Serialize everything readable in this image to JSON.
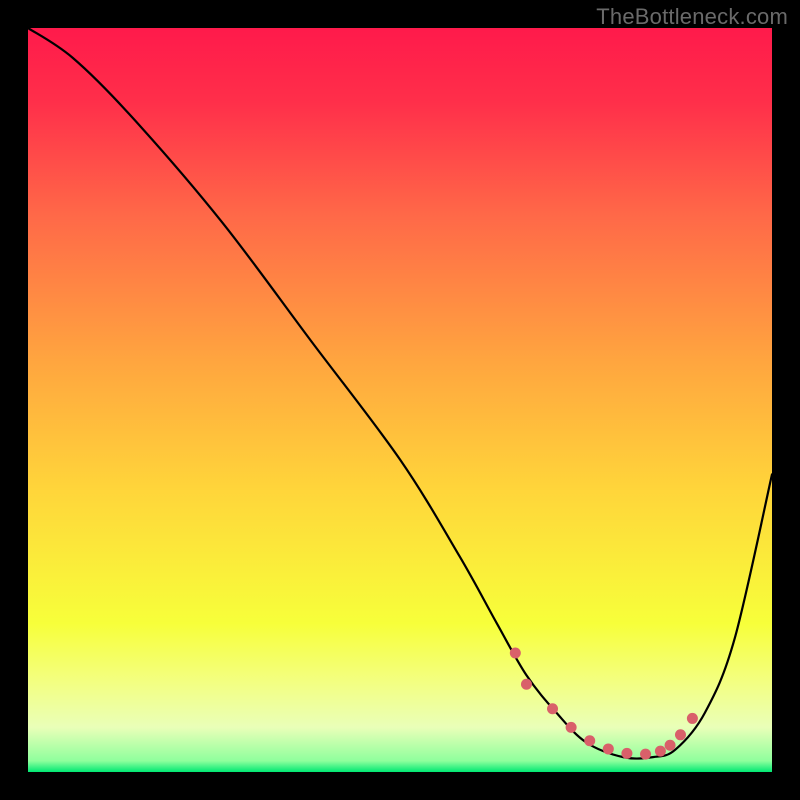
{
  "watermark": "TheBottleneck.com",
  "colors": {
    "background": "#000000",
    "gradient_stops": [
      {
        "offset": 0.0,
        "color": "#ff1a4b"
      },
      {
        "offset": 0.1,
        "color": "#ff2f4a"
      },
      {
        "offset": 0.25,
        "color": "#ff6848"
      },
      {
        "offset": 0.45,
        "color": "#ffa63f"
      },
      {
        "offset": 0.62,
        "color": "#ffd53a"
      },
      {
        "offset": 0.8,
        "color": "#f7ff3a"
      },
      {
        "offset": 0.88,
        "color": "#f3ff82"
      },
      {
        "offset": 0.94,
        "color": "#e9ffb8"
      },
      {
        "offset": 0.985,
        "color": "#8fff9d"
      },
      {
        "offset": 1.0,
        "color": "#00e873"
      }
    ],
    "curve": "#000000",
    "dots": "#d9606a"
  },
  "chart_data": {
    "type": "line",
    "title": "",
    "xlabel": "",
    "ylabel": "",
    "xlim": [
      0,
      100
    ],
    "ylim": [
      0,
      100
    ],
    "grid": false,
    "legend": false,
    "series": [
      {
        "name": "curve",
        "x": [
          0,
          6,
          14,
          26,
          38,
          50,
          58,
          63,
          67,
          71,
          75,
          80,
          84,
          87,
          91,
          95,
          100
        ],
        "values": [
          100,
          96,
          88,
          74,
          58,
          42,
          29,
          20,
          13,
          8,
          4,
          2,
          2,
          3,
          8,
          18,
          40
        ]
      }
    ],
    "dot_marks": {
      "x": [
        65.5,
        67.0,
        70.5,
        73.0,
        75.5,
        78.0,
        80.5,
        83.0,
        85.0,
        86.3,
        87.7,
        89.3
      ],
      "values": [
        16.0,
        11.8,
        8.5,
        6.0,
        4.2,
        3.1,
        2.5,
        2.4,
        2.8,
        3.6,
        5.0,
        7.2
      ]
    }
  }
}
